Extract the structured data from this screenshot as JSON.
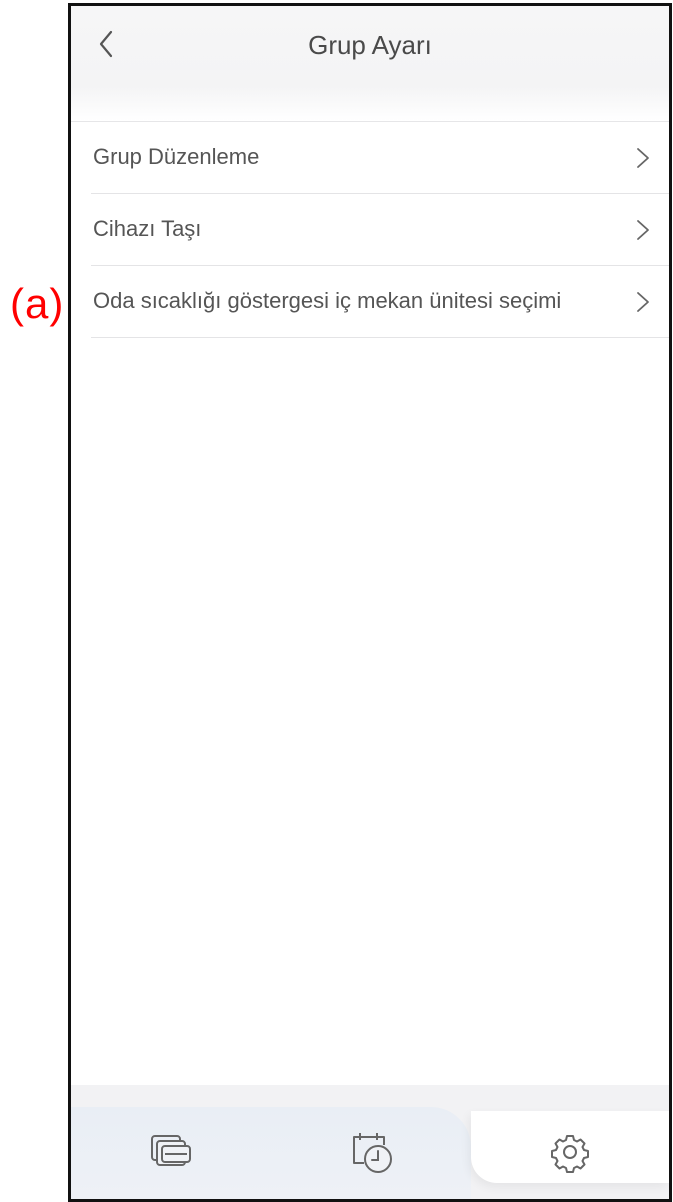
{
  "annotation": {
    "label": "(a)",
    "color": "#ff0000"
  },
  "header": {
    "title": "Grup Ayarı",
    "back_icon": "chevron-left-icon"
  },
  "menu": {
    "items": [
      {
        "label": "Grup Düzenleme",
        "icon": "chevron-right-icon"
      },
      {
        "label": "Cihazı Taşı",
        "icon": "chevron-right-icon"
      },
      {
        "label": "Oda sıcaklığı göstergesi iç mekan ünitesi seçimi",
        "icon": "chevron-right-icon"
      }
    ]
  },
  "tabbar": {
    "tabs": [
      {
        "icon": "devices-icon",
        "active": false
      },
      {
        "icon": "schedule-clock-icon",
        "active": false
      },
      {
        "icon": "gear-icon",
        "active": true
      }
    ]
  },
  "colors": {
    "text": "#555555",
    "title": "#4a4a4a",
    "divider": "#e4e4e6",
    "tabbar_bg": "#f2f2f4"
  }
}
